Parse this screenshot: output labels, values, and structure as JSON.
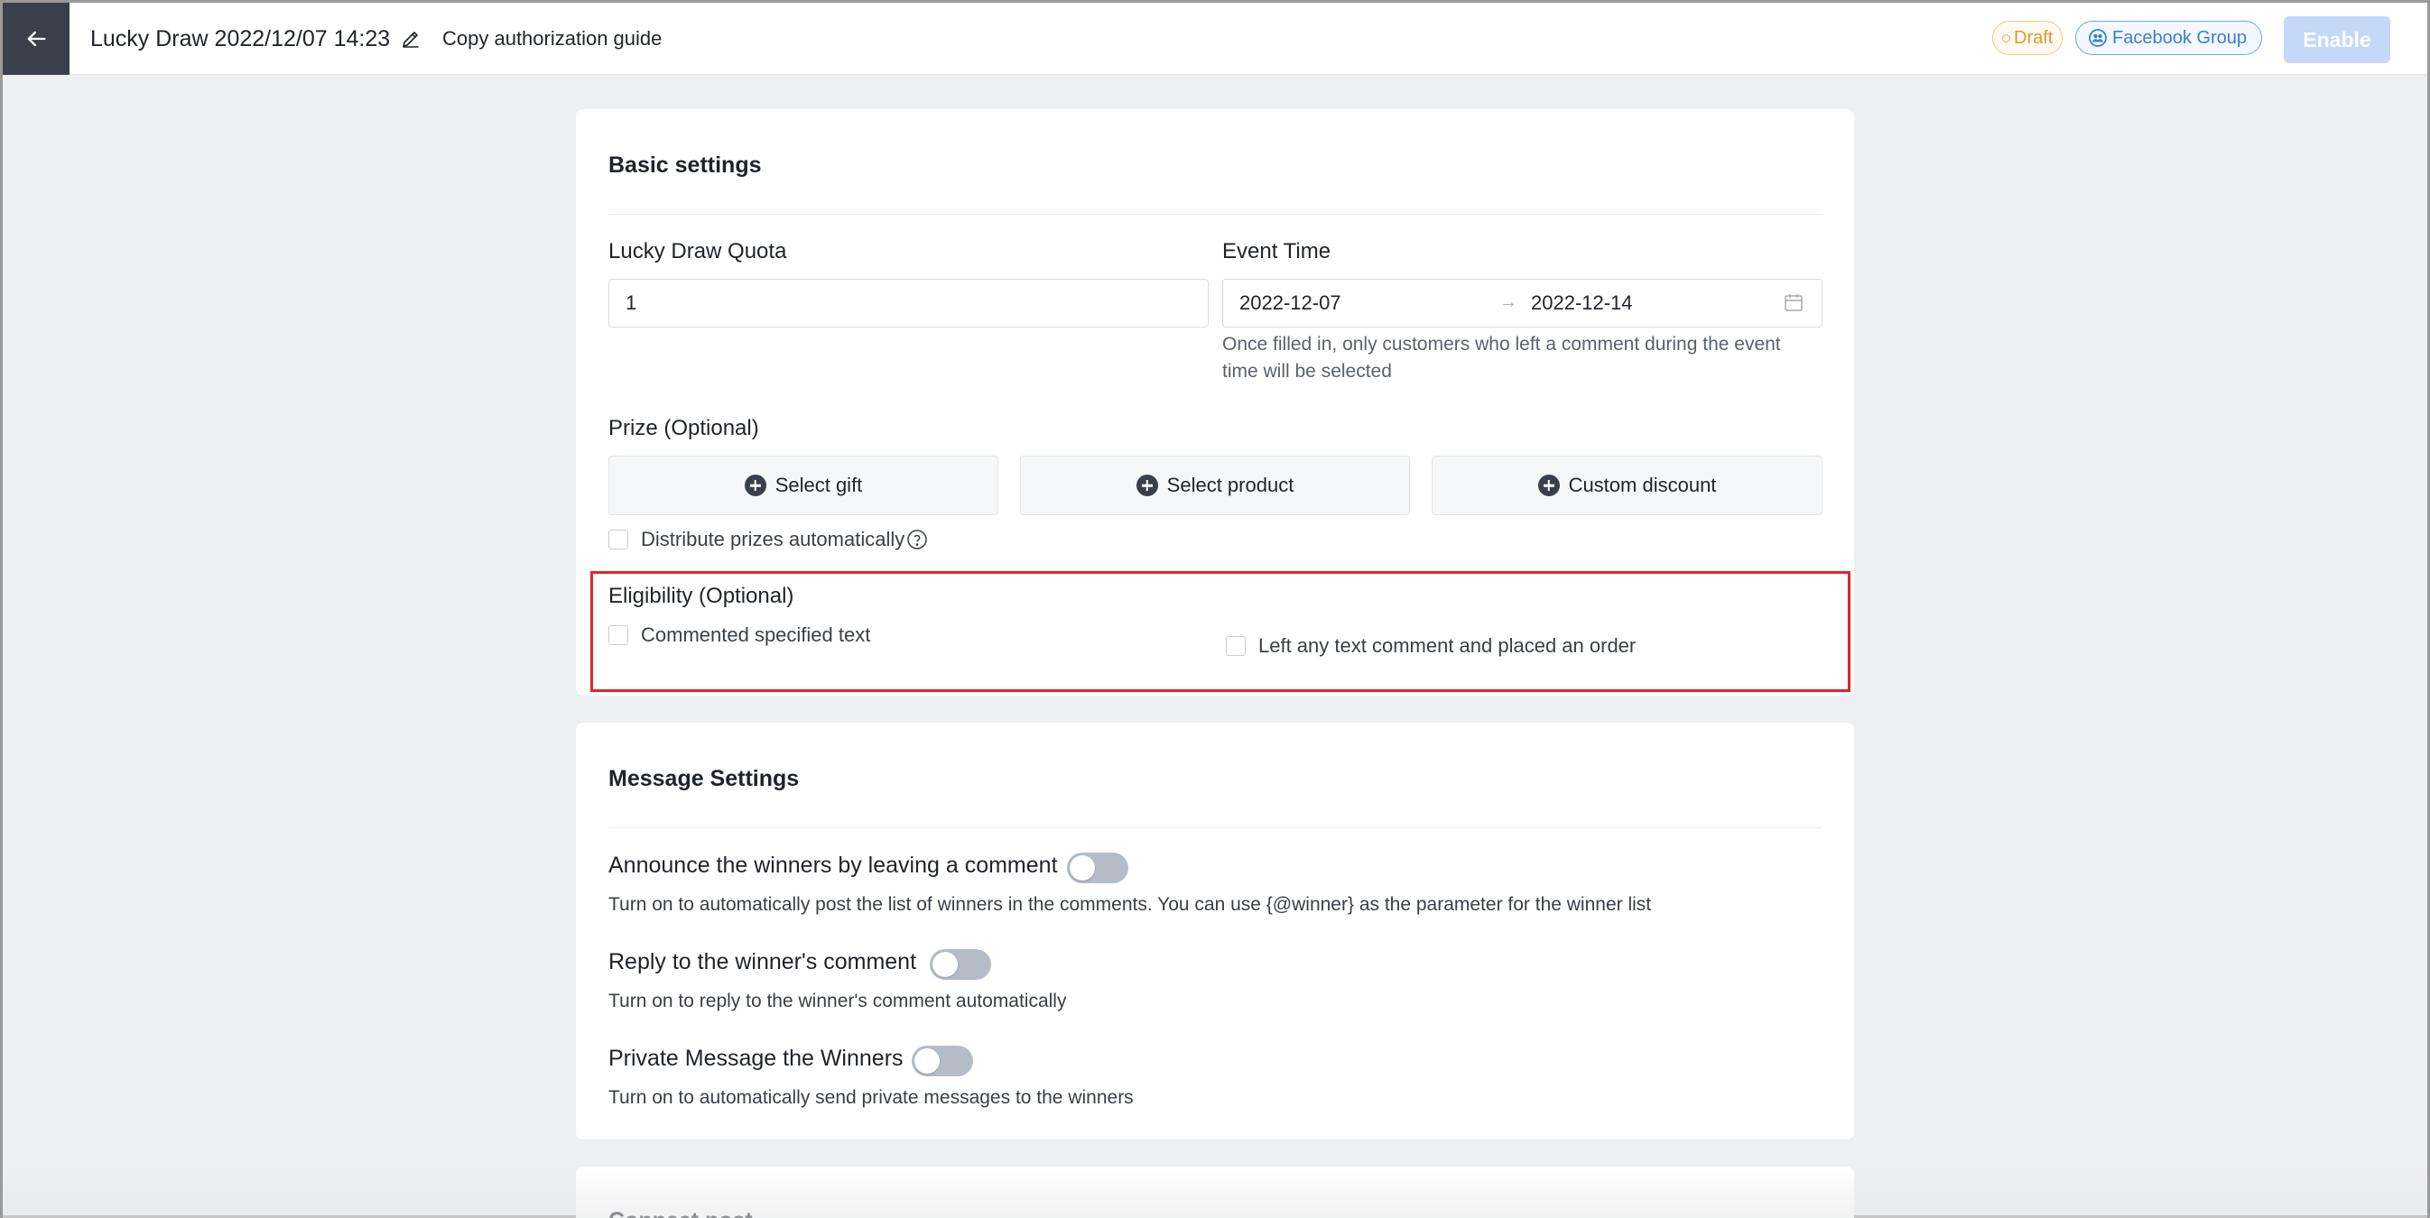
{
  "header": {
    "title": "Lucky Draw 2022/12/07 14:23",
    "guide_link": "Copy authorization guide",
    "status_badge": "Draft",
    "platform_badge": "Facebook Group",
    "enable_label": "Enable",
    "icons": [
      "arrow-left-icon",
      "pencil-icon",
      "people-icon"
    ]
  },
  "basic": {
    "title": "Basic settings",
    "quota_label": "Lucky Draw Quota",
    "quota_value": "1",
    "event_time_label": "Event Time",
    "start_date": "2022-12-07",
    "end_date": "2022-12-14",
    "range_separator": "→",
    "event_help_line1": "Once filled in, only customers who left a comment during the event",
    "event_help_line2": "time will be selected",
    "prize_label": "Prize (Optional)",
    "prize_buttons": [
      "Select gift",
      "Select product",
      "Custom discount"
    ],
    "auto_distribute_label": "Distribute prizes automatically",
    "eligibility_label": "Eligibility (Optional)",
    "eligibility_options": [
      "Commented specified text",
      "Left any text comment and placed an order"
    ]
  },
  "message": {
    "title": "Message Settings",
    "items": [
      {
        "label": "Announce the winners by leaving a comment",
        "desc": "Turn on to automatically post the list of winners in the comments. You can use {@winner} as the parameter for the winner list",
        "enabled": false
      },
      {
        "label": "Reply to the winner's comment",
        "desc": "Turn on to reply to the winner's comment automatically",
        "enabled": false
      },
      {
        "label": "Private Message the Winners",
        "desc": "Turn on to automatically send private messages to the winners",
        "enabled": false
      }
    ]
  },
  "connect": {
    "title": "Connect post"
  },
  "colors": {
    "accent": "#3a7fd1",
    "draft": "#e29a2c",
    "highlight": "#e0262a",
    "enable_disabled": "#c3d9f7"
  }
}
